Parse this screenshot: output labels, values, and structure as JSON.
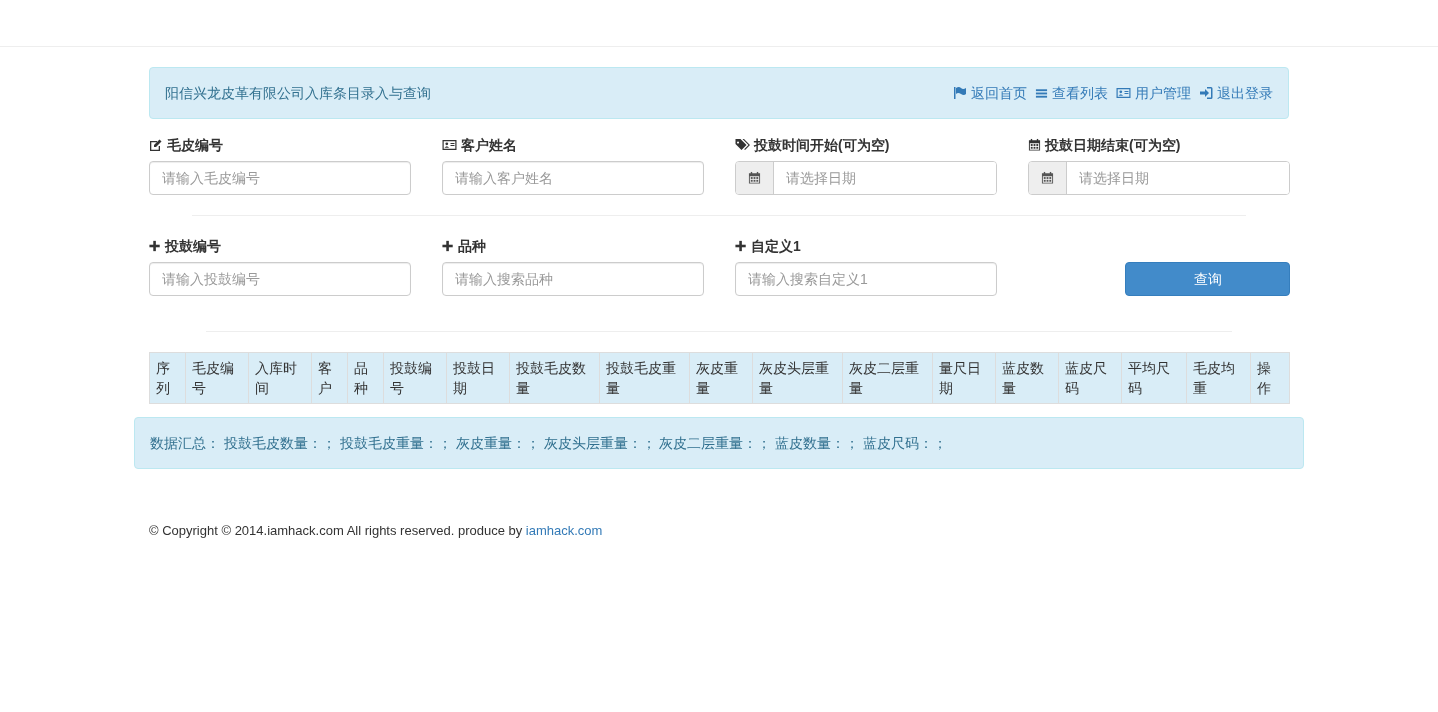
{
  "header": {
    "title": "阳信兴龙皮革有限公司入库条目录入与查询",
    "links": [
      "返回首页",
      "查看列表",
      "用户管理",
      "退出登录"
    ]
  },
  "filters": [
    [
      {
        "kind": "text",
        "label": "毛皮编号",
        "placeholder": "请输入毛皮编号"
      },
      {
        "kind": "text",
        "label": "客户姓名",
        "placeholder": "请输入客户姓名"
      },
      {
        "kind": "date",
        "label": "投鼓时间开始(可为空)",
        "placeholder": "请选择日期"
      },
      {
        "kind": "date",
        "label": "投鼓日期结束(可为空)",
        "placeholder": "请选择日期"
      }
    ],
    [
      {
        "kind": "text",
        "label": "投鼓编号",
        "placeholder": "请输入投鼓编号"
      },
      {
        "kind": "text",
        "label": "品种",
        "placeholder": "请输入搜索品种"
      },
      {
        "kind": "text",
        "label": "自定义1",
        "placeholder": "请输入搜索自定义1"
      }
    ]
  ],
  "search_button": "查询",
  "table": {
    "columns": [
      "序列",
      "毛皮编号",
      "入库时间",
      "客户",
      "品种",
      "投鼓编号",
      "投鼓日期",
      "投鼓毛皮数量",
      "投鼓毛皮重量",
      "灰皮重量",
      "灰皮头层重量",
      "灰皮二层重量",
      "量尺日期",
      "蓝皮数量",
      "蓝皮尺码",
      "平均尺码",
      "毛皮均重",
      "操作"
    ]
  },
  "summary": "数据汇总： 投鼓毛皮数量：； 投鼓毛皮重量：； 灰皮重量：； 灰皮头层重量：； 灰皮二层重量：； 蓝皮数量：； 蓝皮尺码：；",
  "footer": {
    "text": "© Copyright © 2014.iamhack.com All rights reserved. produce by ",
    "link": "iamhack.com"
  }
}
